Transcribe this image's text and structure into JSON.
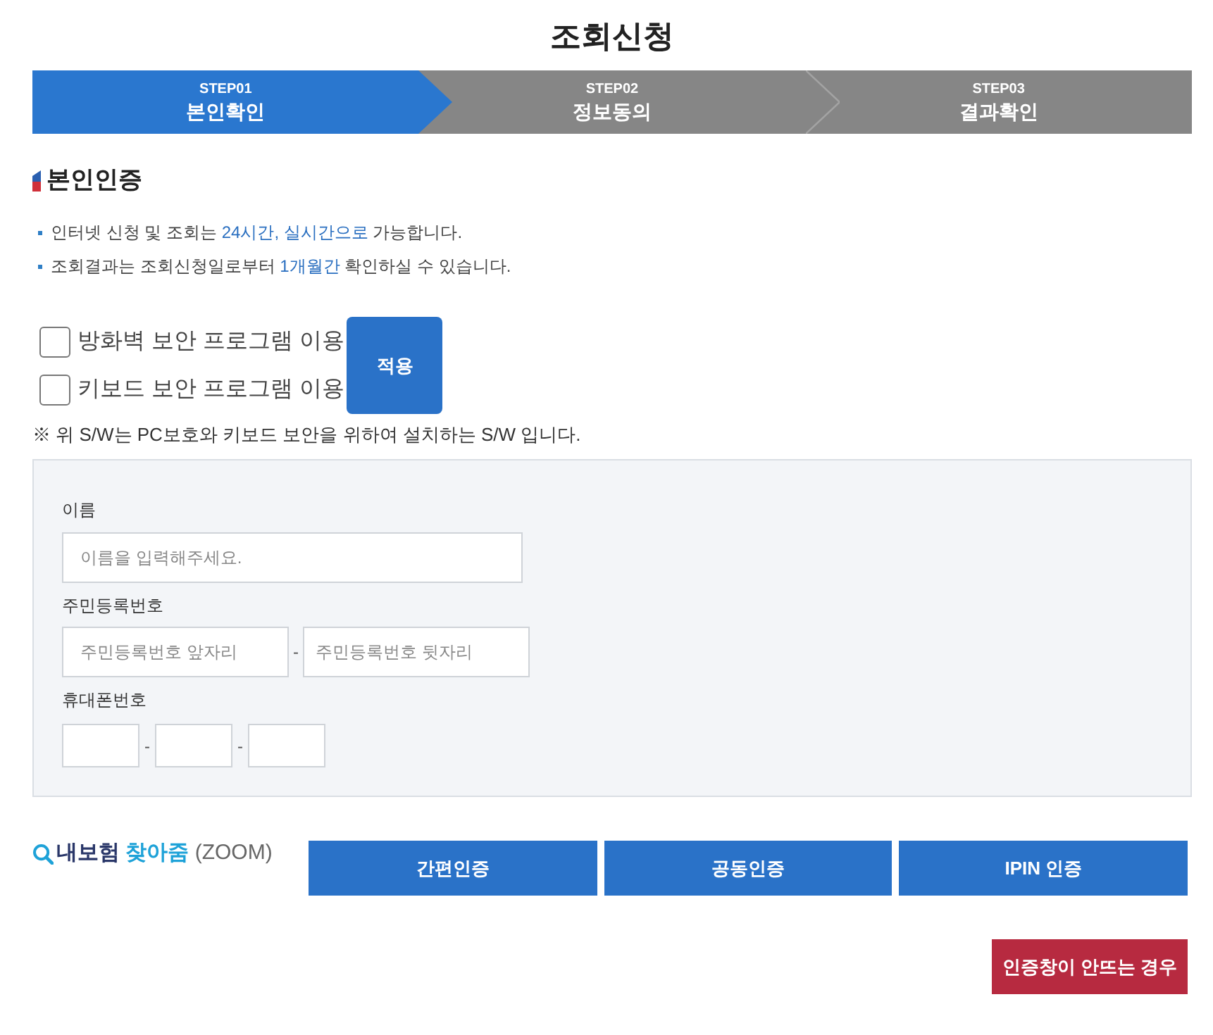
{
  "page": {
    "title": "조회신청"
  },
  "steps": [
    {
      "number": "STEP01",
      "label": "본인확인",
      "selected": true
    },
    {
      "number": "STEP02",
      "label": "정보동의",
      "selected": false
    },
    {
      "number": "STEP03",
      "label": "결과확인",
      "selected": false
    }
  ],
  "section": {
    "title": "본인인증"
  },
  "notices": [
    {
      "segments": [
        {
          "text": "인터넷 신청 및 조회는 ",
          "highlight": false
        },
        {
          "text": "24시간, 실시간으로",
          "highlight": true
        },
        {
          "text": " 가능합니다.",
          "highlight": false
        }
      ]
    },
    {
      "segments": [
        {
          "text": "조회결과는 조회신청일로부터 ",
          "highlight": false
        },
        {
          "text": "1개월간",
          "highlight": true
        },
        {
          "text": " 확인하실 수 있습니다.",
          "highlight": false
        }
      ]
    }
  ],
  "security_programs": {
    "options": [
      {
        "label": "방화벽 보안 프로그램 이용",
        "checked": false
      },
      {
        "label": "키보드 보안 프로그램 이용",
        "checked": false
      }
    ],
    "apply_button": "적용",
    "note": "※ 위 S/W는 PC보호와 키보드 보안을 위하여 설치하는 S/W 입니다."
  },
  "form": {
    "name": {
      "label": "이름",
      "placeholder": "이름을 입력해주세요."
    },
    "resident_number": {
      "label": "주민등록번호",
      "front_placeholder": "주민등록번호 앞자리",
      "separator": "-",
      "back_placeholder": "주민등록번호 뒷자리"
    },
    "phone": {
      "label": "휴대폰번호",
      "separators": [
        "-",
        "-"
      ]
    }
  },
  "zoom_logo": {
    "parts": [
      {
        "text": "내보험 ",
        "kind": "dark"
      },
      {
        "text": "찾아줌 ",
        "kind": "accent"
      },
      {
        "text": "(ZOOM)",
        "kind": "muted"
      }
    ]
  },
  "auth_buttons": [
    "간편인증",
    "공동인증",
    "IPIN 인증"
  ],
  "help_button": "인증창이 안뜨는 경우"
}
